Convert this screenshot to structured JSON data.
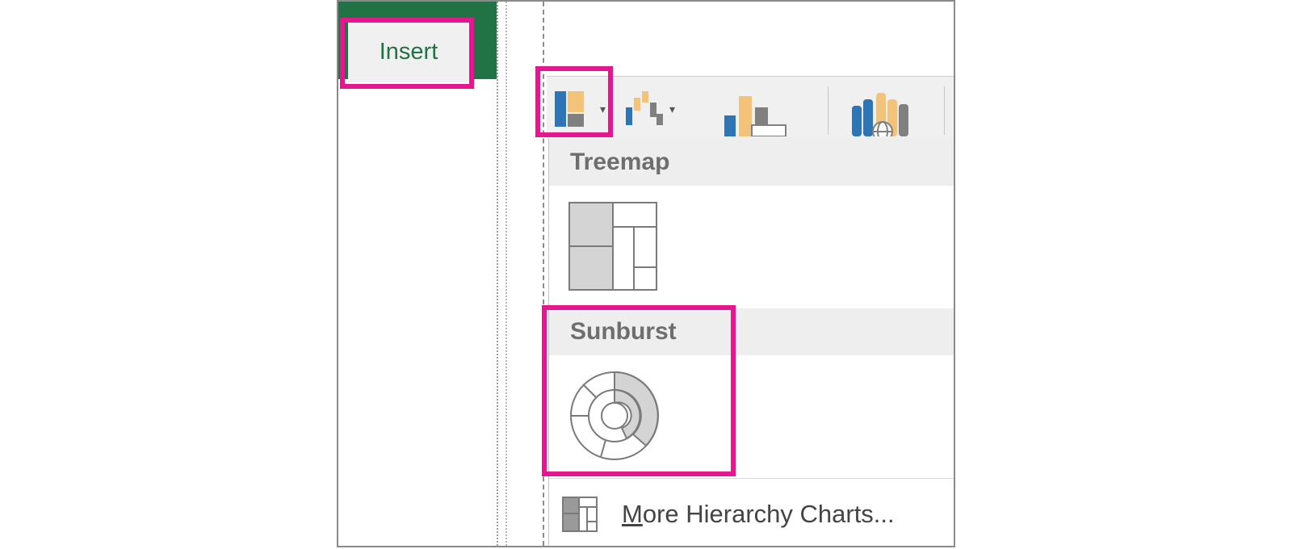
{
  "ribbon": {
    "insert_tab_label": "Insert"
  },
  "ribbon_buttons": [
    {
      "icon": "hierarchy-chart-icon",
      "has_dropdown": true
    },
    {
      "icon": "waterfall-chart-icon",
      "has_dropdown": true
    },
    {
      "icon": "pivot-chart-icon",
      "has_dropdown": false
    },
    {
      "icon": "3d-map-icon",
      "has_dropdown": false
    }
  ],
  "gallery": {
    "sections": [
      {
        "title": "Treemap",
        "items": [
          {
            "icon": "treemap-chart-icon"
          }
        ]
      },
      {
        "title": "Sunburst",
        "items": [
          {
            "icon": "sunburst-chart-icon"
          }
        ]
      }
    ],
    "more_link": {
      "accel": "M",
      "rest": "ore Hierarchy Charts...",
      "icon": "more-hierarchy-icon"
    }
  },
  "colors": {
    "ribbon_green": "#217346",
    "highlight": "#e6168f",
    "chart_blue": "#2e75b6",
    "chart_orange": "#f4b183",
    "chart_gray": "#808080"
  }
}
